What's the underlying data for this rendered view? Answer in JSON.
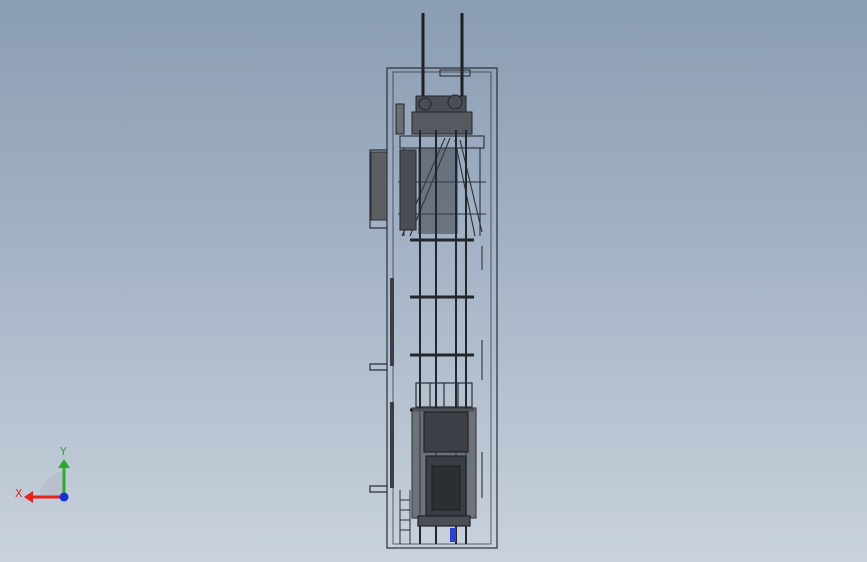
{
  "viewport": {
    "background_top": "#8b9db3",
    "background_bottom": "#c9d2dc"
  },
  "triad": {
    "x_label": "X",
    "y_label": "Y",
    "x_color": "#e8231c",
    "y_color": "#2fa82f",
    "z_color": "#1a2fd6"
  },
  "model": {
    "line_color": "#2a2f36",
    "panel_color": "#5c5f62"
  }
}
